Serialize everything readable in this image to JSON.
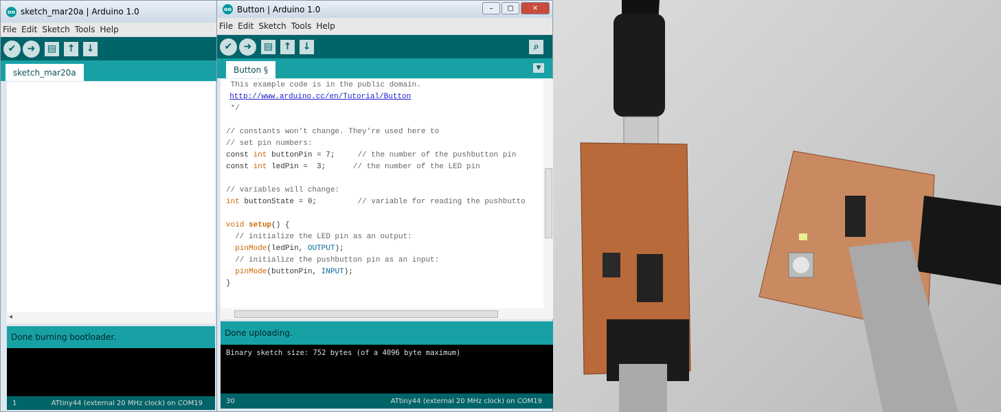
{
  "left": {
    "title": "sketch_mar20a | Arduino 1.0",
    "menu": [
      "File",
      "Edit",
      "Sketch",
      "Tools",
      "Help"
    ],
    "tab": "sketch_mar20a",
    "status": "Done burning bootloader.",
    "line": "1",
    "board": "ATtiny44 (external 20 MHz clock) on COM19"
  },
  "main": {
    "title": "Button | Arduino 1.0",
    "menu": [
      "File",
      "Edit",
      "Sketch",
      "Tools",
      "Help"
    ],
    "tab": "Button §",
    "code": {
      "l1": " This example code is in the public domain.",
      "url": "http://www.arduino.cc/en/Tutorial/Button",
      "l3": " */",
      "l5": "// constants won't change. They're used here to",
      "l6": "// set pin numbers:",
      "l7a": "const ",
      "l7b": "int",
      "l7c": " buttonPin = 7;     ",
      "l7d": "// the number of the pushbutton pin",
      "l8a": "const ",
      "l8b": "int",
      "l8c": " ledPin =  3;      ",
      "l8d": "// the number of the LED pin",
      "l10": "// variables will change:",
      "l11a": "int",
      "l11b": " buttonState = 0;         ",
      "l11c": "// variable for reading the pushbutto",
      "l13a": "void ",
      "l13b": "setup",
      "l13c": "() {",
      "l14": "  // initialize the LED pin as an output:",
      "l15a": "  ",
      "l15b": "pinMode",
      "l15c": "(ledPin, ",
      "l15d": "OUTPUT",
      "l15e": ");",
      "l16": "  // initialize the pushbutton pin as an input:",
      "l17a": "  ",
      "l17b": "pinMode",
      "l17c": "(buttonPin, ",
      "l17d": "INPUT",
      "l17e": ");",
      "l18": "}"
    },
    "status": "Done uploading.",
    "console": "Binary sketch size: 752 bytes (of a 4096 byte maximum)",
    "line": "30",
    "board": "ATtiny44 (external 20 MHz clock) on COM19",
    "window_buttons": [
      "–",
      "▢",
      "✕"
    ]
  },
  "icons": [
    "verify-icon",
    "upload-icon",
    "new-icon",
    "open-icon",
    "save-icon",
    "serial-monitor-icon",
    "tab-menu-icon"
  ],
  "colors": {
    "teal_dark": "#006468",
    "teal": "#17a1a5",
    "board": "#b86a3a"
  }
}
